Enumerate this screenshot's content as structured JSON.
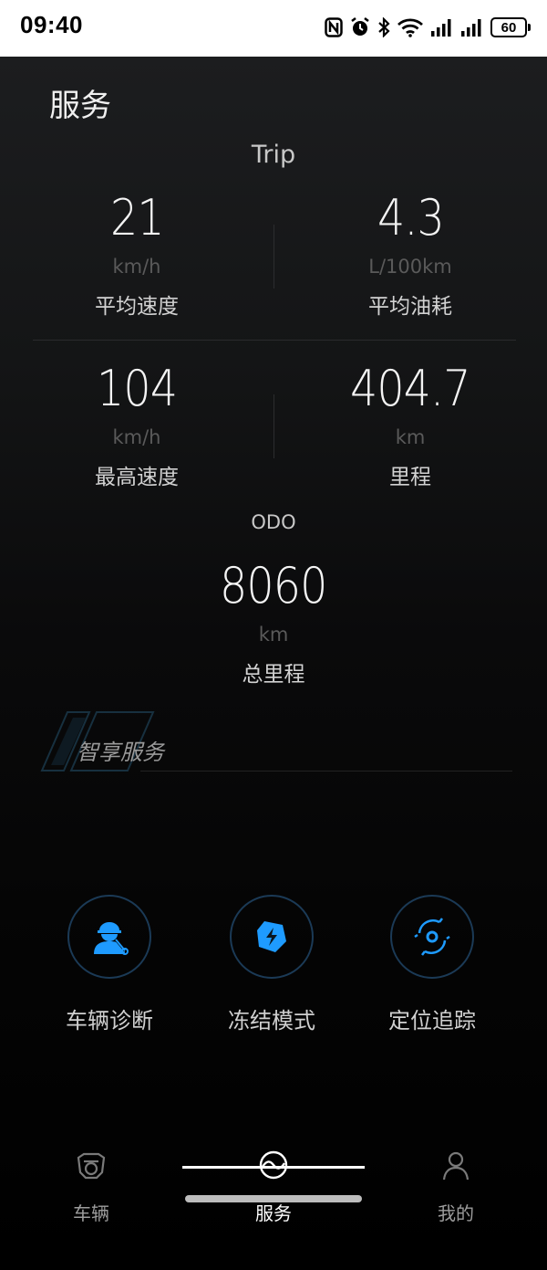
{
  "status_bar": {
    "time": "09:40",
    "battery": "60",
    "icons": [
      "nfc-icon",
      "alarm-icon",
      "bluetooth-icon",
      "wifi-icon",
      "signal-icon",
      "signal-icon",
      "battery-icon"
    ]
  },
  "page": {
    "title": "服务"
  },
  "trip": {
    "label": "Trip",
    "avg_speed": {
      "value": "21",
      "unit": "km/h",
      "name": "平均速度"
    },
    "avg_fuel": {
      "value": "4.3",
      "unit": "L/100km",
      "name": "平均油耗"
    },
    "max_speed": {
      "value": "104",
      "unit": "km/h",
      "name": "最高速度"
    },
    "mileage": {
      "value": "404.7",
      "unit": "km",
      "name": "里程"
    }
  },
  "odo": {
    "label": "ODO",
    "total": {
      "value": "8060",
      "unit": "km",
      "name": "总里程"
    }
  },
  "smart_services": {
    "title": "智享服务",
    "items": [
      {
        "label": "车辆诊断",
        "icon": "mechanic-icon"
      },
      {
        "label": "冻结模式",
        "icon": "freeze-shield-icon"
      },
      {
        "label": "定位追踪",
        "icon": "location-tracking-icon"
      }
    ]
  },
  "tabbar": {
    "tabs": [
      {
        "label": "车辆",
        "icon": "vehicle-icon",
        "active": false
      },
      {
        "label": "服务",
        "icon": "service-icon",
        "active": true
      },
      {
        "label": "我的",
        "icon": "profile-icon",
        "active": false
      }
    ]
  },
  "colors": {
    "accent": "#1e9bff",
    "ring": "#1b3a56",
    "muted_unit": "#5a5a5a"
  }
}
